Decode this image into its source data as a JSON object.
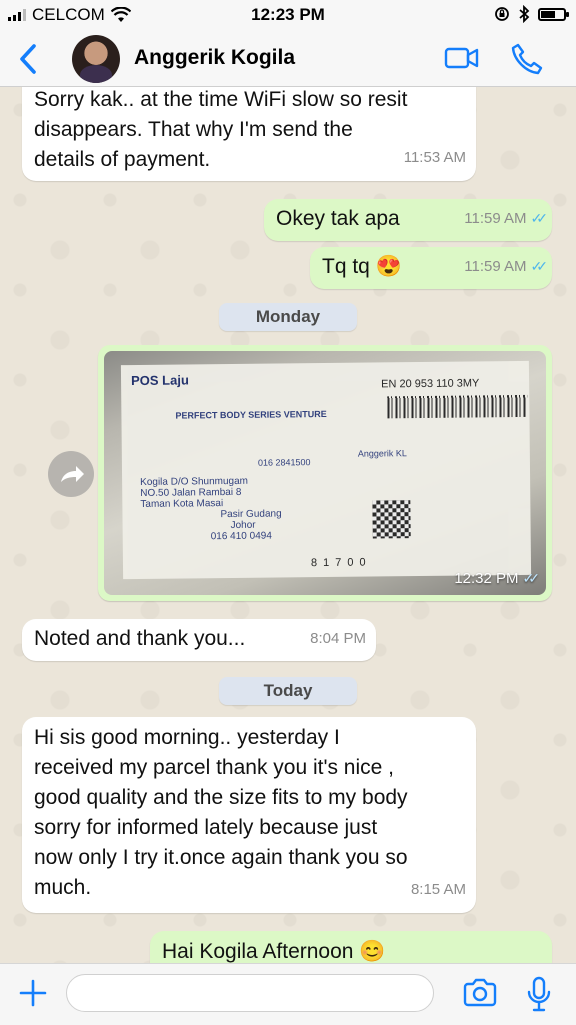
{
  "status_bar": {
    "carrier": "CELCOM",
    "time": "12:23 PM"
  },
  "header": {
    "contact_name": "Anggerik Kogila"
  },
  "messages": [
    {
      "direction": "incoming",
      "text_lines": [
        "Sorry kak.. at the time WiFi slow so resit",
        "disappears. That why I'm send the",
        "details of payment."
      ],
      "time": "11:53 AM"
    },
    {
      "direction": "outgoing",
      "text": "Okey tak apa",
      "time": "11:59 AM"
    },
    {
      "direction": "outgoing",
      "text": "Tq tq",
      "emoji": "😍",
      "time": "11:59 AM"
    },
    {
      "direction": "incoming",
      "text": "Noted and thank you...",
      "time": "8:04 PM"
    },
    {
      "direction": "incoming",
      "text_lines": [
        "Hi sis good morning.. yesterday I",
        "received my parcel thank you it's nice ,",
        "good quality and the size fits to my body",
        "sorry for informed lately because just",
        "now only I try it.once again thank you so",
        "much."
      ],
      "time": "8:15 AM"
    },
    {
      "direction": "outgoing",
      "text": "Hai Kogila Afternoon",
      "emoji": "😊"
    }
  ],
  "day_separators": [
    "Monday",
    "Today"
  ],
  "image_message": {
    "time": "12:32 PM",
    "receipt": {
      "brand": "POS Laju",
      "tracking": "EN 20 953 110 3MY",
      "sender": "PERFECT BODY SERIES VENTURE",
      "recipient_lines": [
        "Kogila D/O Shunmugam",
        "NO.50 Jalan Rambai 8",
        "Taman Kota Masai",
        "Pasir Gudang",
        "Johor",
        "016 410 0494"
      ],
      "phone": "016 2841500",
      "name_tag": "Anggerik KL",
      "postcode": "81700"
    }
  },
  "input": {
    "placeholder": ""
  }
}
